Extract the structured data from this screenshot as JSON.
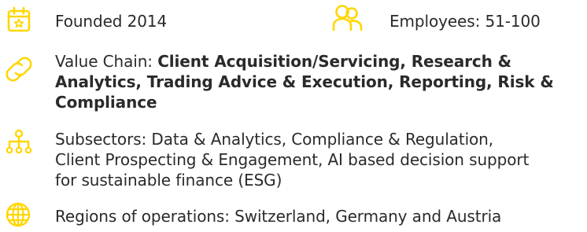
{
  "accent_color": "#ffd600",
  "founded": {
    "icon": "calendar-star-icon",
    "text": "Founded 2014"
  },
  "employees": {
    "icon": "people-icon",
    "text": "Employees: 51-100"
  },
  "value_chain": {
    "icon": "link-icon",
    "label": "Value Chain: ",
    "values": [
      "Client Acquisition/Servicing, Research &",
      "Analytics, Trading Advice & Execution, Reporting, Risk &",
      "Compliance"
    ]
  },
  "subsectors": {
    "icon": "hierarchy-icon",
    "lines": [
      "Subsectors: Data & Analytics, Compliance & Regulation,",
      "Client Prospecting & Engagement, AI based decision support",
      "for sustainable finance (ESG)"
    ]
  },
  "regions": {
    "icon": "globe-icon",
    "text": "Regions of operations: Switzerland, Germany and Austria"
  }
}
